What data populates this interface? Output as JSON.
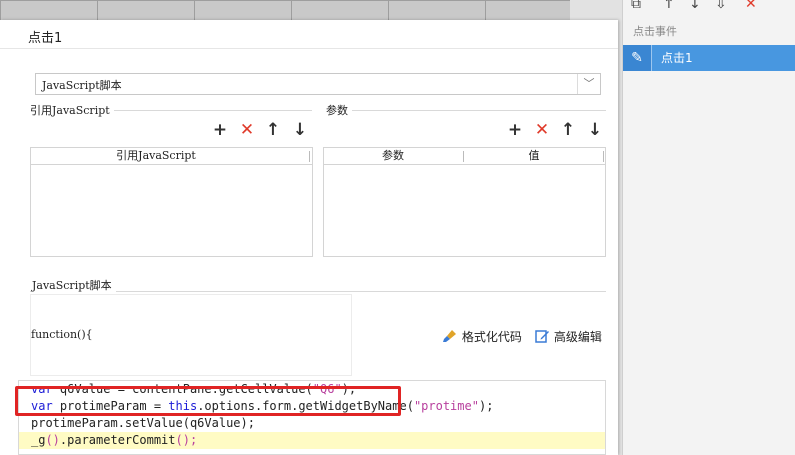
{
  "dialog": {
    "title": "点击1",
    "script_type": "JavaScript脚本",
    "ref_js_group": "引用JavaScript",
    "params_group": "参数",
    "ref_js_column": "引用JavaScript",
    "params_columns": {
      "param": "参数",
      "value": "值"
    },
    "script_group": "JavaScript脚本",
    "function_signature": "function(){",
    "format_code": "格式化代码",
    "advanced_edit": "高级编辑",
    "code": {
      "line1": {
        "kw": "var",
        "pre": " q6Value = contentPane.getCellValue(",
        "str": "\"Q6\"",
        "post": ");"
      },
      "line2": {
        "kw1": "var",
        "mid1": " protimeParam = ",
        "kw2": "this",
        "mid2": ".options.form.getWidgetByName(",
        "str": "\"protime\"",
        "post": ");"
      },
      "line3": "protimeParam.setValue(q6Value);",
      "line4": {
        "pre": "_g",
        "paren": "()",
        "post": ".parameterCommit",
        "tail": "();"
      }
    }
  },
  "right_panel": {
    "header": "点击事件",
    "selected_item": "点击1"
  },
  "icons": {
    "add": "+",
    "delete": "✕",
    "up": "↑",
    "down": "↓",
    "dropdown": "﹀",
    "edit": "✎",
    "format": "brush-icon",
    "advanced": "edit-icon"
  },
  "colors": {
    "accent": "#4897e0",
    "delete": "#e03a2a",
    "keyword": "#1b1bd6",
    "string": "#b8409e",
    "highlight": "#e02424"
  }
}
